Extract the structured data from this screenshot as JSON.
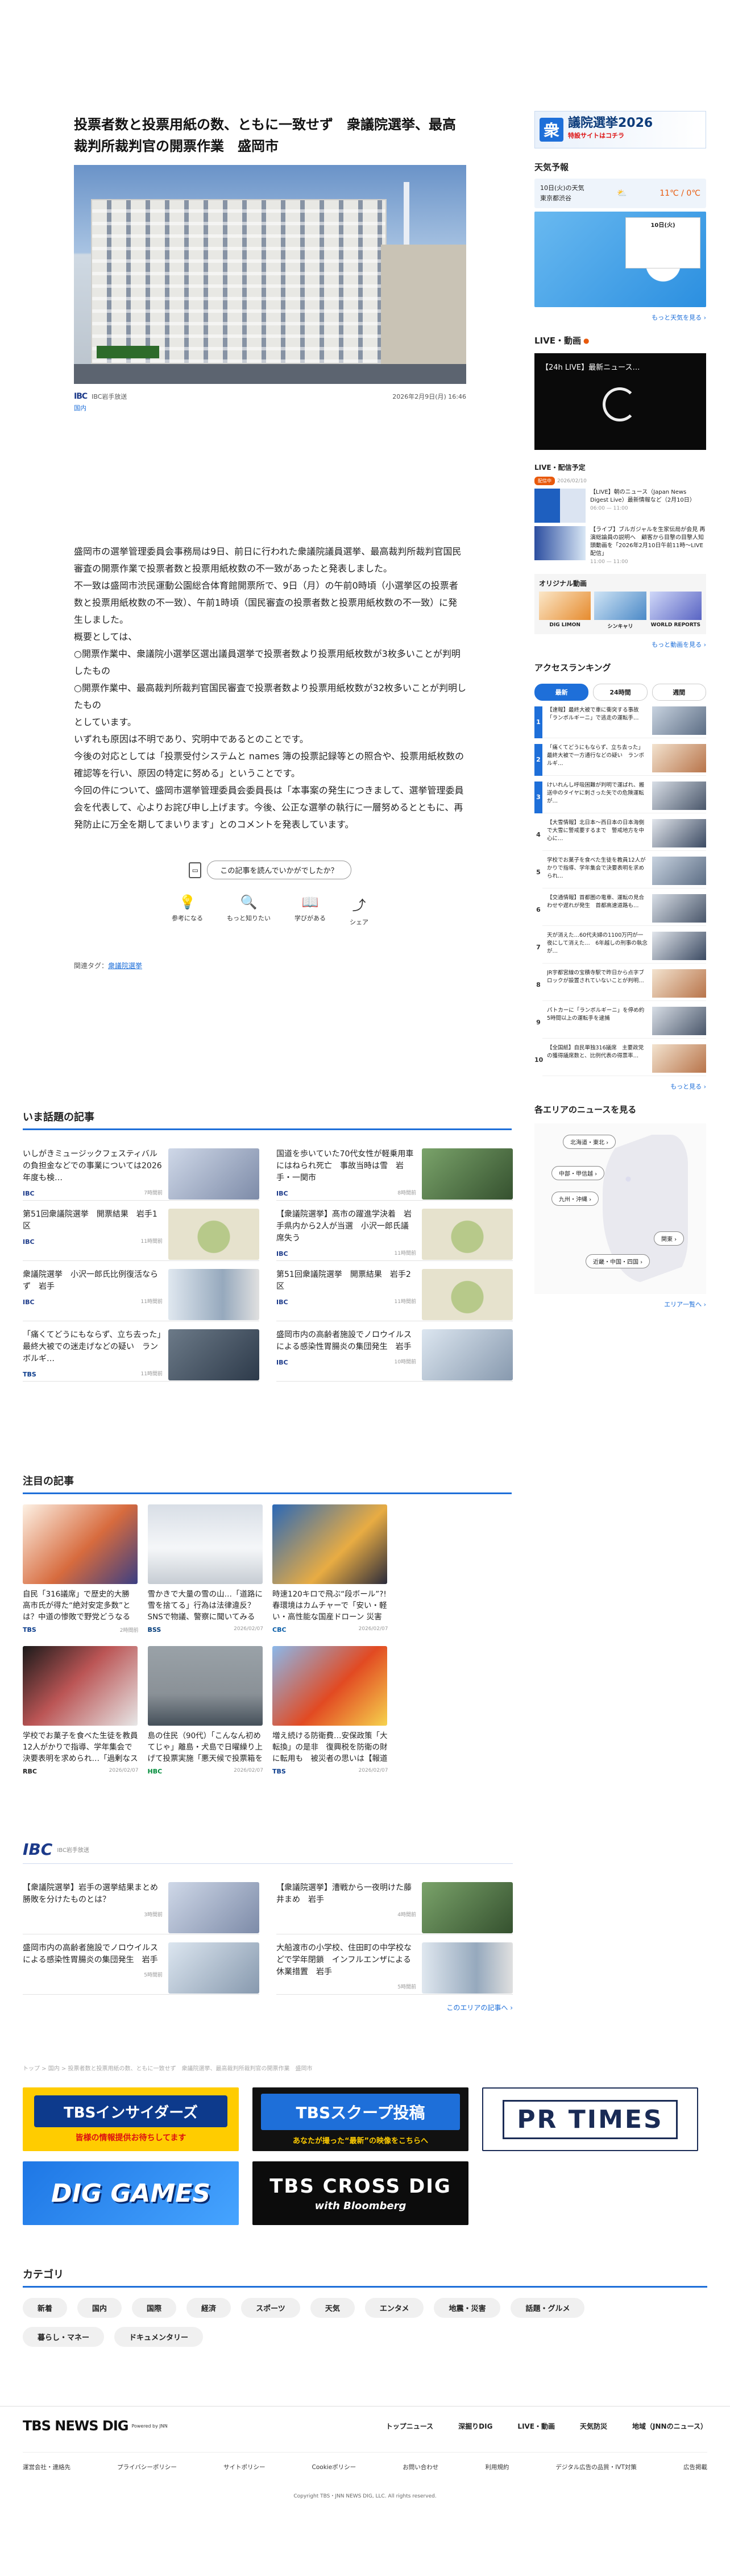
{
  "article": {
    "title": "投票者数と投票用紙の数、ともに一致せず　衆議院選挙、最高裁判所裁判官の開票作業　盛岡市",
    "source_logo": "IBC",
    "source_name": "IBC岩手放送",
    "area": "国内",
    "date": "2026年2月9日(月) 16:46",
    "paragraphs": [
      "盛岡市の選挙管理委員会事務局は9日、前日に行われた衆議院議員選挙、最高裁判所裁判官国民審査の開票作業で投票者数と投票用紙枚数の不一致があったと発表しました。",
      "不一致は盛岡市渋民運動公園総合体育館開票所で、9日（月）の午前0時頃（小選挙区の投票者数と投票用紙枚数の不一致）、午前1時頃（国民審査の投票者数と投票用紙枚数の不一致）に発生しました。",
      "概要としては、",
      "○開票作業中、衆議院小選挙区選出議員選挙で投票者数より投票用紙枚数が3枚多いことが判明したもの",
      "○開票作業中、最高裁判所裁判官国民審査で投票者数より投票用紙枚数が32枚多いことが判明したもの",
      "としています。",
      "いずれも原因は不明であり、究明中であるとのことです。",
      "今後の対応としては「投票受付システムと names 簿の投票記録等との照合や、投票用紙枚数の確認等を行い、原因の特定に努める」ということです。",
      "今回の件について、盛岡市選挙管理委員会委員長は「本事案の発生につきまして、選挙管理委員会を代表して、心よりお詫び申し上げます。今後、公正な選挙の執行に一層努めるとともに、再発防止に万全を期してまいります」とのコメントを発表しています。"
    ],
    "feedback_question": "この記事を読んでいかがでしたか？",
    "reactions": [
      {
        "icon": "💡",
        "label": "参考になる"
      },
      {
        "icon": "🔍",
        "label": "もっと知りたい"
      },
      {
        "icon": "📖",
        "label": "学びがある"
      },
      {
        "icon": "⤴",
        "label": "シェア"
      }
    ],
    "tags_label": "関連タグ：",
    "tag": "衆議院選挙"
  },
  "hot": {
    "title": "いま話題の記事",
    "items": [
      {
        "text": "いしがきミュージックフェスティバルの負担金などでの事業については2026年度も検…",
        "src": "IBC",
        "time": "7時間前"
      },
      {
        "text": "国道を歩いていた70代女性が軽乗用車にはねられ死亡　事故当時は雪　岩手・一関市",
        "src": "IBC",
        "time": "8時間前"
      },
      {
        "text": "第51回衆議院選挙　開票結果　岩手1区",
        "src": "IBC",
        "time": "11時間前"
      },
      {
        "text": "【衆議院選挙】髙市の躍進学決着　岩手県内から2人が当選　小沢一郎氏議席失う",
        "src": "IBC",
        "time": "11時間前"
      },
      {
        "text": "衆議院選挙　小沢一郎氏比例復活ならず　岩手",
        "src": "IBC",
        "time": "11時間前"
      },
      {
        "text": "第51回衆議院選挙　開票結果　岩手2区",
        "src": "IBC",
        "time": "11時間前"
      },
      {
        "text": "「痛くてどうにもならず、立ち去った」最終大被での迷走げなどの疑い　ランボルギ…",
        "src": "TBS",
        "time": "11時間前"
      },
      {
        "text": "盛岡市内の高齢者施設でノロウイルスによる感染性胃腸炎の集団発生　岩手",
        "src": "IBC",
        "time": "10時間前"
      }
    ]
  },
  "featured": {
    "title": "注目の記事",
    "items": [
      {
        "text": "自民「316議席」で歴史的大勝　高市氏が得た“絶対安定多数”とは？中道の惨敗で野党どうなる【N入…",
        "src": "TBS",
        "time": "2時間前"
      },
      {
        "text": "雪かきで大量の雪の山…「道路に雪を捨てる」行為は法律違反？　SNSで物議、警察に聞いてみると…「…",
        "src": "BSS",
        "time": "2026/02/07"
      },
      {
        "text": "時速120キロで飛ぶ“段ボール”?!  春環境はカムチャーで「安い・軽い・高性能な国産ドローン 災害時の捜索や…",
        "src": "CBC",
        "time": "2026/02/07"
      },
      {
        "text": "",
        "src": "",
        "time": ""
      },
      {
        "text": "学校でお菓子を食べた生徒を教員12人がかりで指導、学年集会で決要表明を求められ…「過剰なストレ…",
        "src": "RBC",
        "time": "2026/02/07"
      },
      {
        "text": "島の住民（90代）「こんなん初めてじゃ」離島・犬島で日曜繰り上げて投票実施「悪天候で投票箱を船で…",
        "src": "HBC",
        "time": "2026/02/07"
      },
      {
        "text": "増え続ける防衛費…安保政策「大転換」の是非　復興税を防衛の財に転用も　被災者の思いは【報道特集】",
        "src": "TBS",
        "time": "2026/02/07"
      },
      {
        "text": "",
        "src": "",
        "time": ""
      }
    ]
  },
  "ibc": {
    "logo": "IBC",
    "label": "IBC岩手放送",
    "items": [
      {
        "text": "【衆議院選挙】岩手の選挙結果まとめ　勝敗を分けたものとは？",
        "time": "3時間前"
      },
      {
        "text": "【衆議院選挙】漕戦から一夜明けた藤井まめ　岩手",
        "time": "4時間前"
      },
      {
        "text": "盛岡市内の高齢者施設でノロウイルスによる感染性胃腸炎の集団発生　岩手",
        "time": "5時間前"
      },
      {
        "text": "大船渡市の小学校、住田町の中学校などで学年閉鎖　インフルエンザによる休業措置　岩手",
        "time": "5時間前"
      }
    ],
    "more": "このエリアの記事へ ›"
  },
  "breadcrumb": "トップ > 国内 > 投票者数と投票用紙の数、ともに一致せず　衆議院選挙、最高裁判所裁判官の開票作業　盛岡市",
  "banners": {
    "b1_main": "TBSインサイダーズ",
    "b1_sub": "皆様の情報提供お待ちしてます",
    "b2_main": "TBSスクープ投稿",
    "b2_sub": "あなたが撮った“最新”の映像をこちらへ",
    "b3_main": "PR TIMES",
    "b4_main": "DIG GAMES",
    "b5_main": "TBS CROSS DIG",
    "b5_sub": "with Bloomberg"
  },
  "categories": {
    "title": "カテゴリ",
    "items": [
      "新着",
      "国内",
      "国際",
      "経済",
      "スポーツ",
      "天気",
      "エンタメ",
      "地震・災害",
      "話題・グルメ",
      "暮らし・マネー",
      "ドキュメンタリー"
    ]
  },
  "footer": {
    "logo": "TBS NEWS DIG",
    "by": "Powered by JNN",
    "nav": [
      "トップニュース",
      "深掘りDIG",
      "LIVE・動画",
      "天気防災",
      "地域（JNNのニュース）"
    ],
    "links": [
      "運営会社・連絡先",
      "プライバシーポリシー",
      "サイトポリシー",
      "Cookieポリシー",
      "お問い合わせ",
      "利用規約",
      "デジタル広告の品質・IVT対策",
      "広告掲載"
    ],
    "copyright": "Copyright TBS・JNN NEWS DIG, LLC. All rights reserved."
  },
  "sidebar": {
    "election_kanji": "衆",
    "election_title": "議院選挙2026",
    "election_sub": "特設サイトはコチラ",
    "weather_title": "天気予報",
    "weather_date": "10日(火)の天気",
    "weather_city": "東京都渋谷",
    "weather_temp": "11℃ / 0℃",
    "weather_map_label": "10日(火)",
    "weather_more": "もっと天気を見る ›",
    "live_title": "LIVE・動画",
    "live_caption": "【24h LIVE】最新ニュース…",
    "sched_title": "LIVE・配信予定",
    "sched_badge": "配信中",
    "sched_date": "2026/02/10",
    "sched": [
      {
        "text": "【LIVE】朝のニュース（Japan News Digest Live）最新情報など（2月10日）",
        "time": "06:00 — 11:00"
      },
      {
        "text": "【ライブ】ブルガジャルを生家伝局が会見 再演総論員の説明へ　顧客から目撃の目撃人知頭動画を「2026年2月10日午前11時〜LIVE配信」",
        "time": "11:00 — 11:00"
      }
    ],
    "orig_title": "オリジナル動画",
    "orig": [
      "DIG LIMON",
      "シンキャリ",
      "WORLD REPORTS"
    ],
    "orig_more": "もっと動画を見る ›",
    "rank_title": "アクセスランキング",
    "rank_tabs": [
      "最新",
      "24時間",
      "週間"
    ],
    "rank": [
      {
        "n": "1",
        "text": "【速報】最終大被で車に衝突する事故「ランボルギーニ」で逃走の運転手…"
      },
      {
        "n": "2",
        "text": "「痛くてどうにもならず、立ち去った」最終大被で一方通行などの疑い　ランボルギ…"
      },
      {
        "n": "3",
        "text": "けいれんし呼吸困難が判明で運ばれ、搬送中のタイヤに刺さった矢での危険運転が…"
      },
      {
        "n": "4",
        "text": "【大雪情報】北日本〜西日本の日本海側で大雪に警戒要するまで　警戒地方を中心に…"
      },
      {
        "n": "5",
        "text": "学校でお菓子を食べた生徒を教員12人がかりで指導、学年集会で決要表明を求められ…"
      },
      {
        "n": "6",
        "text": "【交通情報】首都圏の電車、運転の見合わせや遅れが発生　首都高速道路も…"
      },
      {
        "n": "7",
        "text": "天が消えた…60代夫婦の1100万円が一夜にして消えた…　6年越しの刑事の執念が…"
      },
      {
        "n": "8",
        "text": "JR宇都宮線の宝積寺駅で昨日から点字ブロックが設置されていないことが判明…"
      },
      {
        "n": "9",
        "text": "パトカーに「ランボルギーニ」を停め約5時間以上の運転手を逮捕　"
      },
      {
        "n": "10",
        "text": "【全国紙】自民単独316議席　主要政党の獲得議席数と、比例代表の得票率…"
      }
    ],
    "rank_more": "もっと見る ›",
    "region_title": "各エリアのニュースを見る",
    "regions": [
      "北海道・東北 ›",
      "中部・甲信越 ›",
      "九州・沖縄 ›",
      "関東 ›",
      "近畿・中国・四国 ›"
    ],
    "region_more": "エリア一覧へ ›"
  }
}
